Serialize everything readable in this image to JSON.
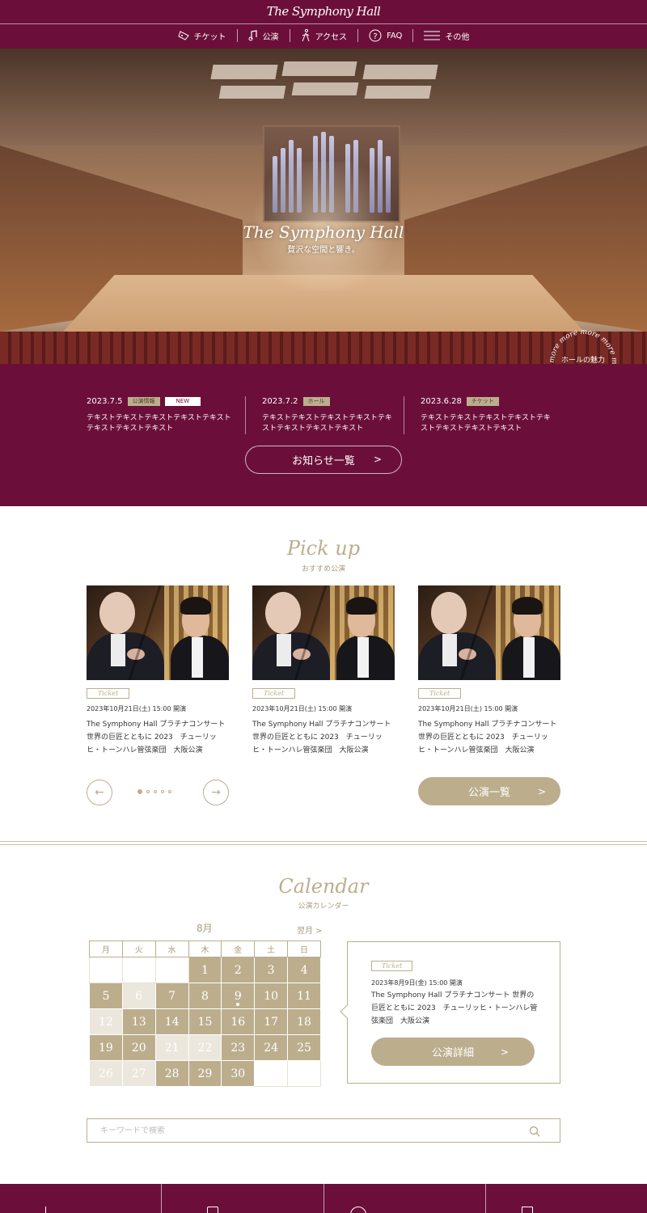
{
  "header": {
    "logo": "The Symphony Hall",
    "nav": [
      {
        "label": "チケット",
        "icon": "ticket-icon"
      },
      {
        "label": "公演",
        "icon": "music-note-icon"
      },
      {
        "label": "アクセス",
        "icon": "walk-icon"
      },
      {
        "label": "FAQ",
        "icon": "question-icon"
      },
      {
        "label": "その他",
        "icon": "menu-icon"
      }
    ]
  },
  "hero": {
    "logo": "The Symphony Hall",
    "tagline": "贅沢な空間と響き。",
    "more_ring_text": "more more more more more more",
    "more_label": "ホールの魅力",
    "more_arrow": ">"
  },
  "news": {
    "items": [
      {
        "date": "2023.7.5",
        "tag": "公演情報",
        "badge": "NEW",
        "text": "テキストテキストテキストテキストテキストテキストテキストテキスト"
      },
      {
        "date": "2023.7.2",
        "tag": "ホール",
        "badge": "",
        "text": "テキストテキストテキストテキストテキストテキストテキストテキスト"
      },
      {
        "date": "2023.6.28",
        "tag": "チケット",
        "badge": "",
        "text": "テキストテキストテキストテキストテキストテキストテキストテキスト"
      }
    ],
    "button_label": "お知らせ一覧",
    "button_chevron": ">"
  },
  "pickup": {
    "title": "Pick up",
    "subtitle": "おすすめ公演",
    "cards": [
      {
        "tag": "Ticket",
        "date": "2023年10月21日(土) 15:00 開演",
        "title": "The Symphony Hall プラチナコンサート 世界の巨匠とともに 2023　チューリッヒ・トーンハレ管弦楽団　大阪公演"
      },
      {
        "tag": "Ticket",
        "date": "2023年10月21日(土) 15:00 開演",
        "title": "The Symphony Hall プラチナコンサート 世界の巨匠とともに 2023　チューリッヒ・トーンハレ管弦楽団　大阪公演"
      },
      {
        "tag": "Ticket",
        "date": "2023年10月21日(土) 15:00 開演",
        "title": "The Symphony Hall プラチナコンサート 世界の巨匠とともに 2023　チューリッヒ・トーンハレ管弦楽団　大阪公演"
      }
    ],
    "prev_arrow": "←",
    "next_arrow": "→",
    "slide_count": 5,
    "active_slide": 1,
    "list_button": "公演一覧",
    "list_chevron": ">"
  },
  "calendar": {
    "title": "Calendar",
    "subtitle": "公演カレンダー",
    "month": "8月",
    "next_month": "翌月 >",
    "weekdays": [
      "月",
      "火",
      "水",
      "木",
      "金",
      "土",
      "日"
    ],
    "weeks": [
      [
        {
          "d": "",
          "s": "empty"
        },
        {
          "d": "",
          "s": "empty"
        },
        {
          "d": "",
          "s": "empty"
        },
        {
          "d": "1",
          "s": "ev"
        },
        {
          "d": "2",
          "s": "ev"
        },
        {
          "d": "3",
          "s": "ev"
        },
        {
          "d": "4",
          "s": "ev"
        }
      ],
      [
        {
          "d": "5",
          "s": "ev"
        },
        {
          "d": "6",
          "s": "pale"
        },
        {
          "d": "7",
          "s": "ev"
        },
        {
          "d": "8",
          "s": "ev"
        },
        {
          "d": "9",
          "s": "ev",
          "selected": true
        },
        {
          "d": "10",
          "s": "ev"
        },
        {
          "d": "11",
          "s": "ev"
        }
      ],
      [
        {
          "d": "12",
          "s": "pale"
        },
        {
          "d": "13",
          "s": "ev"
        },
        {
          "d": "14",
          "s": "ev"
        },
        {
          "d": "15",
          "s": "ev"
        },
        {
          "d": "16",
          "s": "ev"
        },
        {
          "d": "17",
          "s": "ev"
        },
        {
          "d": "18",
          "s": "ev"
        }
      ],
      [
        {
          "d": "19",
          "s": "ev"
        },
        {
          "d": "20",
          "s": "ev"
        },
        {
          "d": "21",
          "s": "pale"
        },
        {
          "d": "22",
          "s": "pale"
        },
        {
          "d": "23",
          "s": "ev"
        },
        {
          "d": "24",
          "s": "ev"
        },
        {
          "d": "25",
          "s": "ev"
        }
      ],
      [
        {
          "d": "26",
          "s": "pale"
        },
        {
          "d": "27",
          "s": "pale"
        },
        {
          "d": "28",
          "s": "ev"
        },
        {
          "d": "29",
          "s": "ev"
        },
        {
          "d": "30",
          "s": "ev"
        },
        {
          "d": "",
          "s": "empty"
        },
        {
          "d": "",
          "s": "empty"
        }
      ]
    ],
    "event": {
      "tag": "Ticket",
      "date": "2023年8月9日(金) 15:00 開演",
      "title": "The Symphony Hall プラチナコンサート 世界の巨匠とともに 2023　チューリッヒ・トーンハレ管弦楽団　大阪公演",
      "button": "公演詳細",
      "button_chevron": ">"
    }
  },
  "search": {
    "placeholder": "キーワードで検索",
    "value": ""
  },
  "colors": {
    "brand": "#6b0f3a",
    "gold": "#bcae8d",
    "gold_pale": "#ebe7dc",
    "white": "#ffffff"
  }
}
